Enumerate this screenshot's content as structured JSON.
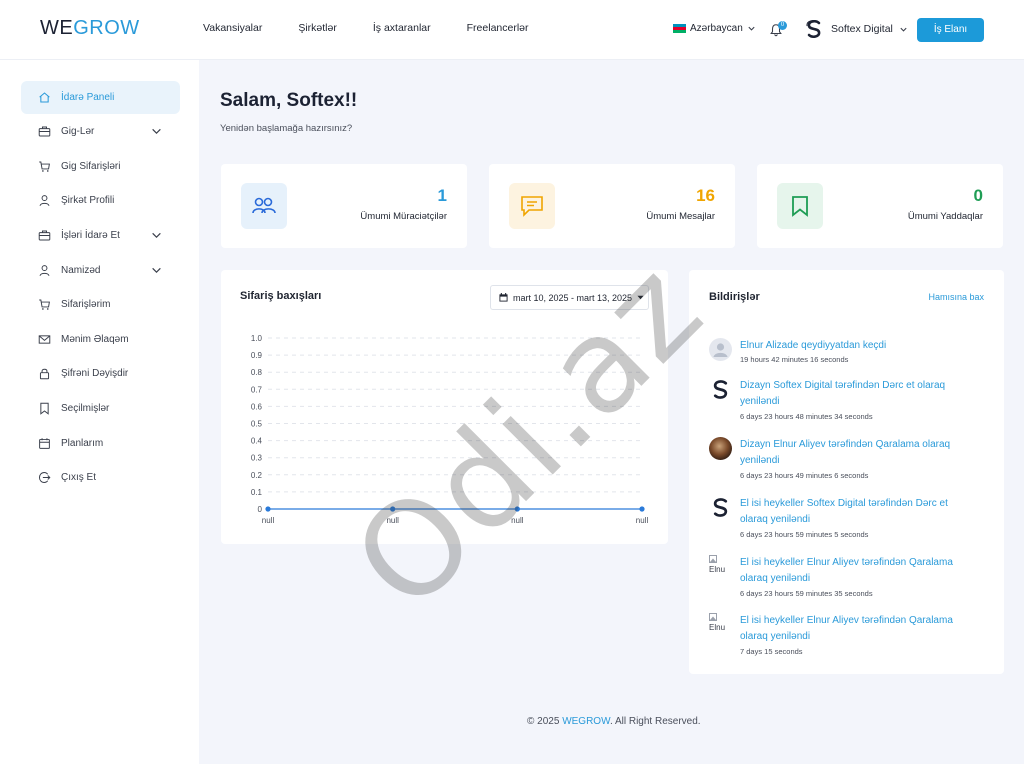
{
  "header": {
    "logo_we": "WE",
    "logo_grow": "GROW",
    "nav": [
      "Vakansiyalar",
      "Şirkətlər",
      "İş axtaranlar",
      "Freelancerlər"
    ],
    "language": "Azərbaycan",
    "notification_count": "0",
    "company_name": "Softex Digital",
    "post_button": "İş Elanı",
    "flag_colors": [
      "#0092bc",
      "#e4002b",
      "#00af66"
    ],
    "accent_color": "#1c9ad9"
  },
  "sidebar": {
    "items": [
      {
        "label": "İdarə Paneli",
        "icon": "home-icon",
        "active": true,
        "expandable": false
      },
      {
        "label": "Gig-Lər",
        "icon": "briefcase-icon",
        "active": false,
        "expandable": true
      },
      {
        "label": "Gig Sifarişləri",
        "icon": "cart-icon",
        "active": false,
        "expandable": false
      },
      {
        "label": "Şirkət Profili",
        "icon": "user-icon",
        "active": false,
        "expandable": false
      },
      {
        "label": "İşləri İdarə Et",
        "icon": "briefcase-icon",
        "active": false,
        "expandable": true
      },
      {
        "label": "Namizəd",
        "icon": "user-icon",
        "active": false,
        "expandable": true
      },
      {
        "label": "Sifarişlərim",
        "icon": "cart-icon",
        "active": false,
        "expandable": false
      },
      {
        "label": "Mənim Əlaqəm",
        "icon": "mail-icon",
        "active": false,
        "expandable": false
      },
      {
        "label": "Şifrəni Dəyişdir",
        "icon": "lock-icon",
        "active": false,
        "expandable": false
      },
      {
        "label": "Seçilmişlər",
        "icon": "bookmark-icon",
        "active": false,
        "expandable": false
      },
      {
        "label": "Planlarım",
        "icon": "calendar-icon",
        "active": false,
        "expandable": false
      },
      {
        "label": "Çıxış Et",
        "icon": "logout-icon",
        "active": false,
        "expandable": false
      }
    ]
  },
  "main": {
    "greeting": "Salam, Softex!!",
    "subtitle": "Yenidən başlamağa hazırsınız?",
    "stats": [
      {
        "value": "1",
        "label": "Ümumi Müraciətçilər",
        "icon": "users-icon",
        "color": "#2a9ad9",
        "bg": "#e6f1fb"
      },
      {
        "value": "16",
        "label": "Ümumi Mesajlar",
        "icon": "message-icon",
        "color": "#f0a500",
        "bg": "#fdf3e0"
      },
      {
        "value": "0",
        "label": "Ümumi Yaddaqlar",
        "icon": "bookmark-icon",
        "color": "#1f9d55",
        "bg": "#e6f5ec"
      }
    ],
    "chart_title": "Sifariş baxışları",
    "date_range": "mart 10, 2025 - mart 13, 2025"
  },
  "chart_data": {
    "type": "line",
    "title": "",
    "categories": [
      "null",
      "null",
      "null",
      "null"
    ],
    "series": [
      {
        "values": [
          0,
          0,
          0,
          0
        ]
      }
    ],
    "ylim": [
      0,
      1.0
    ],
    "yticks": [
      "1.0",
      "0.9",
      "0.8",
      "0.7",
      "0.6",
      "0.5",
      "0.4",
      "0.3",
      "0.2",
      "0.1",
      "0"
    ],
    "grid": true,
    "color": "#2a7ad9"
  },
  "notifications": {
    "title": "Bildirişlər",
    "see_all": "Hamısına bax",
    "items": [
      {
        "text": "Elnur Alizade qeydiyyatdan keçdi",
        "time": "19 hours 42 minutes 16 seconds",
        "avatar": "default-avatar"
      },
      {
        "text": "Dizayn Softex Digital tərəfindən Dərc et olaraq yeniləndi",
        "time": "6 days 23 hours 48 minutes 34 seconds",
        "avatar": "softex-logo"
      },
      {
        "text": "Dizayn Elnur Aliyev tərəfindən Qaralama olaraq yeniləndi",
        "time": "6 days 23 hours 49 minutes 6 seconds",
        "avatar": "photo-avatar"
      },
      {
        "text": "El isi heykeller Softex Digital tərəfindən Dərc et olaraq yeniləndi",
        "time": "6 days 23 hours 59 minutes 5 seconds",
        "avatar": "softex-logo"
      },
      {
        "text": "El isi heykeller Elnur Aliyev tərəfindən Qaralama olaraq yeniləndi",
        "time": "6 days 23 hours 59 minutes 35 seconds",
        "avatar": "broken-image",
        "avatar_alt": "Elnu"
      },
      {
        "text": "El isi heykeller Elnur Aliyev tərəfindən Qaralama olaraq yeniləndi",
        "time": "7 days 15 seconds",
        "avatar": "broken-image",
        "avatar_alt": "Elnu"
      }
    ]
  },
  "footer": {
    "prefix": "© 2025",
    "brand": "WEGROW",
    "suffix": ". All Right Reserved."
  },
  "watermark": "Odi.az"
}
